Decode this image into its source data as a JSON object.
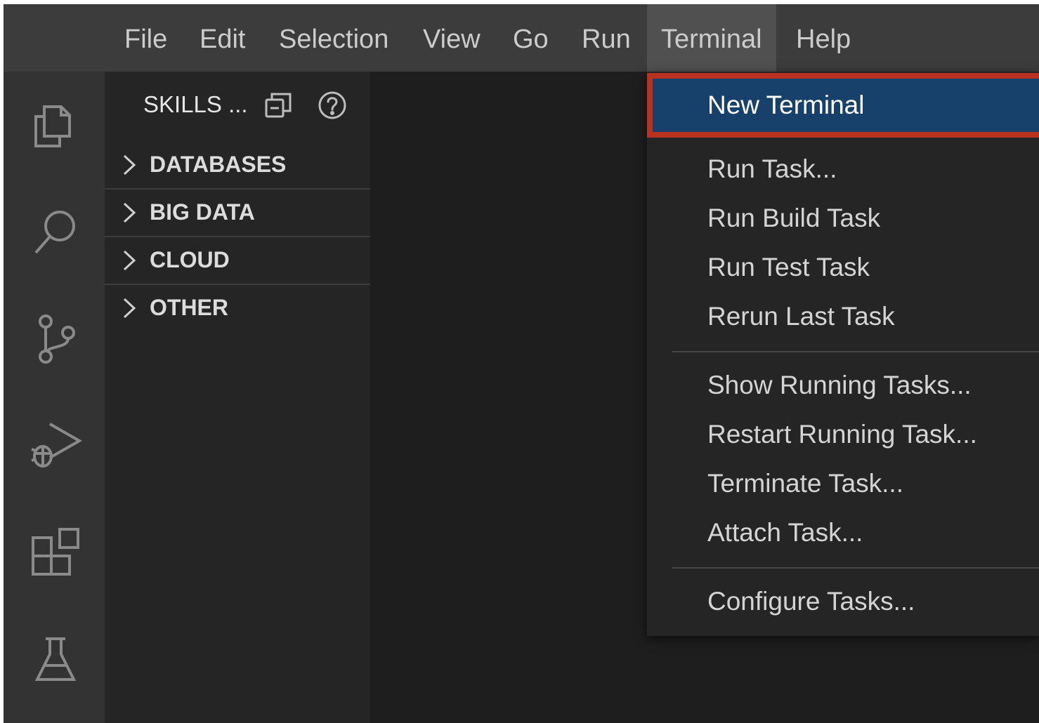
{
  "menubar": {
    "items": [
      {
        "label": "File"
      },
      {
        "label": "Edit"
      },
      {
        "label": "Selection"
      },
      {
        "label": "View"
      },
      {
        "label": "Go"
      },
      {
        "label": "Run"
      },
      {
        "label": "Terminal",
        "active": true
      },
      {
        "label": "Help"
      }
    ]
  },
  "activitybar": {
    "icons": [
      "explorer-icon",
      "search-icon",
      "source-control-icon",
      "run-debug-icon",
      "extensions-icon",
      "testing-icon"
    ]
  },
  "sidebar": {
    "title": "SKILLS ...",
    "sections": [
      {
        "label": "DATABASES"
      },
      {
        "label": "BIG DATA"
      },
      {
        "label": "CLOUD"
      },
      {
        "label": "OTHER"
      }
    ]
  },
  "terminal_menu": {
    "items": [
      {
        "label": "New Terminal",
        "highlighted": true
      },
      {
        "label": "Run Task..."
      },
      {
        "label": "Run Build Task"
      },
      {
        "label": "Run Test Task"
      },
      {
        "label": "Rerun Last Task"
      },
      {
        "label": "Show Running Tasks..."
      },
      {
        "label": "Restart Running Task..."
      },
      {
        "label": "Terminate Task..."
      },
      {
        "label": "Attach Task..."
      },
      {
        "label": "Configure Tasks..."
      }
    ]
  },
  "colors": {
    "menubar_bg": "#3c3c3c",
    "highlight_bg": "#17406b",
    "annotation_border": "#b8321f"
  }
}
